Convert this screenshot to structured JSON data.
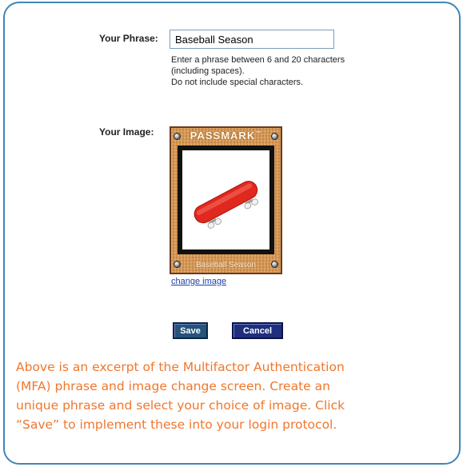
{
  "form": {
    "phrase_label": "Your Phrase:",
    "phrase_value": "Baseball Season",
    "phrase_help": [
      "Enter a phrase between 6 and 20 characters",
      "(including spaces).",
      "Do not include special characters."
    ],
    "image_label": "Your Image:",
    "passmark": {
      "brand": "PASSMARK",
      "trademark": "™",
      "caption": "Baseball Season",
      "image_subject": "red skateboard"
    },
    "change_image_link": "change image",
    "save_label": "Save",
    "cancel_label": "Cancel"
  },
  "caption_lines": [
    "Above is an excerpt of the Multifactor Authentication",
    "(MFA) phrase and image change screen. Create an",
    "unique phrase and select your choice of image. Click",
    "“Save” to implement these into your login protocol."
  ],
  "colors": {
    "card_border": "#3f86b8",
    "caption_text": "#f0772d",
    "button_bg": "#1f2f7e",
    "link": "#1b3fa5",
    "skateboard": "#e0281e"
  }
}
